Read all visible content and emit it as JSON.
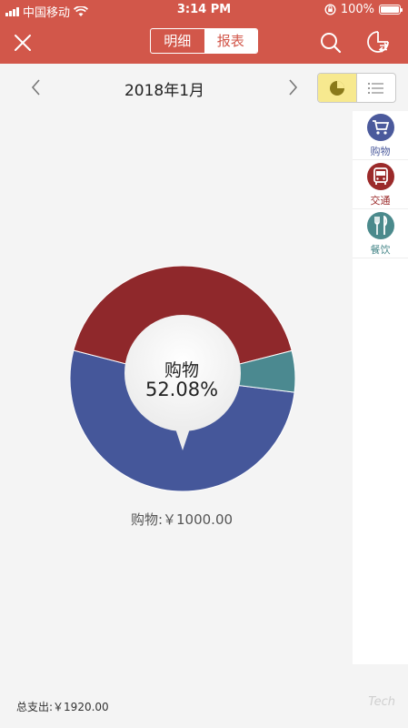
{
  "status_bar": {
    "carrier": "中国移动",
    "time": "3:14 PM",
    "battery": "100%"
  },
  "navbar": {
    "tabs": [
      {
        "label": "明细",
        "active": false
      },
      {
        "label": "报表",
        "active": true
      }
    ],
    "close_icon": "close-icon",
    "search_icon": "search-icon",
    "chart_icon": "chart-switch-icon"
  },
  "month_bar": {
    "month": "2018年1月",
    "view_toggle": [
      "pie-view-icon",
      "list-view-icon"
    ],
    "active_view": "pie"
  },
  "categories": [
    {
      "label": "购物",
      "icon": "cart-icon",
      "color": "#4b5a9c"
    },
    {
      "label": "交通",
      "icon": "bus-icon",
      "color": "#9b2a2a"
    },
    {
      "label": "餐饮",
      "icon": "fork-knife-icon",
      "color": "#4b8a8c"
    }
  ],
  "chart_data": {
    "type": "pie",
    "style": "donut",
    "slices": [
      {
        "label": "购物",
        "percent": 52.08,
        "value": 1000.0,
        "color": "#45579a"
      },
      {
        "label": "交通",
        "percent": 42.0,
        "color": "#8f282b"
      },
      {
        "label": "餐饮",
        "percent": 5.92,
        "color": "#4b8990"
      }
    ],
    "center_label": "购物",
    "center_value": "52.08%"
  },
  "summary": {
    "text": "购物:￥1000.00"
  },
  "footer": {
    "total": "总支出:￥1920.00",
    "watermark": "Tech"
  }
}
